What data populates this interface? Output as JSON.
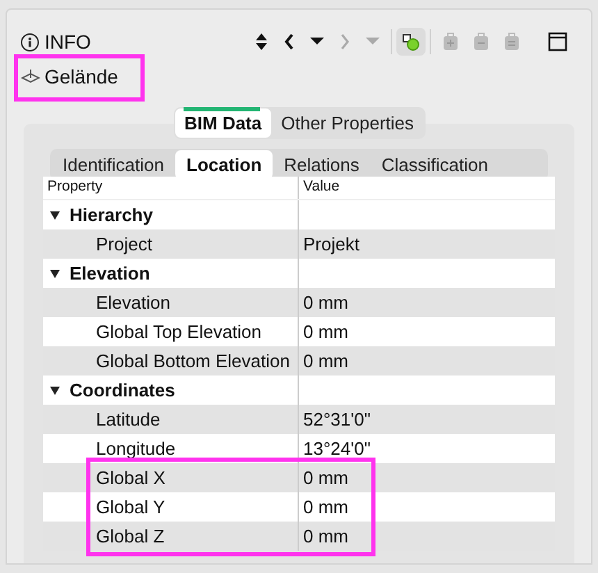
{
  "panel": {
    "title": "INFO"
  },
  "toolbar": [
    {
      "kind": "updown",
      "disabled": false,
      "selected": false
    },
    {
      "kind": "prev",
      "disabled": false,
      "selected": false
    },
    {
      "kind": "dropdown",
      "disabled": false,
      "selected": false
    },
    {
      "kind": "next",
      "disabled": true,
      "selected": false
    },
    {
      "kind": "dropdown",
      "disabled": true,
      "selected": false
    },
    {
      "kind": "cubes",
      "disabled": false,
      "selected": true
    },
    {
      "kind": "bag-plus",
      "disabled": true,
      "selected": false
    },
    {
      "kind": "bag-minus",
      "disabled": true,
      "selected": false
    },
    {
      "kind": "bag-lines",
      "disabled": true,
      "selected": false
    },
    {
      "kind": "window",
      "disabled": false,
      "selected": false
    }
  ],
  "subject": {
    "name": "Gelände",
    "highlighted": true
  },
  "main_tabs": [
    {
      "label": "BIM Data",
      "selected": true
    },
    {
      "label": "Other Properties",
      "selected": false
    }
  ],
  "sub_tabs": [
    {
      "label": "Identification",
      "selected": false
    },
    {
      "label": "Location",
      "selected": true
    },
    {
      "label": "Relations",
      "selected": false
    },
    {
      "label": "Classification",
      "selected": false
    }
  ],
  "table": {
    "columns": [
      "Property",
      "Value"
    ],
    "groups": [
      {
        "name": "Hierarchy",
        "expanded": true,
        "rows": [
          {
            "property": "Project",
            "value": "Projekt",
            "highlighted": false
          }
        ]
      },
      {
        "name": "Elevation",
        "expanded": true,
        "rows": [
          {
            "property": "Elevation",
            "value": "0 mm",
            "highlighted": false
          },
          {
            "property": "Global Top Elevation",
            "value": "0 mm",
            "highlighted": false
          },
          {
            "property": "Global Bottom Elevation",
            "value": "0 mm",
            "highlighted": false
          }
        ]
      },
      {
        "name": "Coordinates",
        "expanded": true,
        "rows": [
          {
            "property": "Latitude",
            "value": "52°31'0\"",
            "highlighted": false
          },
          {
            "property": "Longitude",
            "value": "13°24'0\"",
            "highlighted": false
          },
          {
            "property": "Global X",
            "value": "0 mm",
            "highlighted": true
          },
          {
            "property": "Global Y",
            "value": "0 mm",
            "highlighted": true
          },
          {
            "property": "Global Z",
            "value": "0 mm",
            "highlighted": true
          }
        ]
      }
    ]
  }
}
